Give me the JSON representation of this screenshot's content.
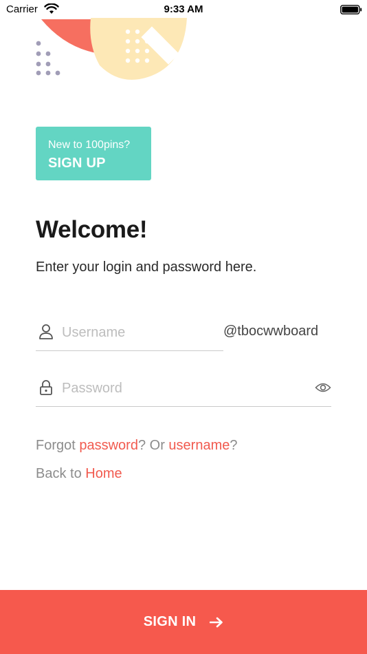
{
  "status_bar": {
    "carrier": "Carrier",
    "time": "9:33 AM"
  },
  "signup": {
    "prompt": "New to 100pins?",
    "action_label": "SIGN UP"
  },
  "heading": "Welcome!",
  "subtitle": "Enter your login and password here.",
  "username_field": {
    "placeholder": "Username",
    "value": "",
    "domain_suffix": "@tbocwwboard"
  },
  "password_field": {
    "placeholder": "Password",
    "value": ""
  },
  "forgot": {
    "prefix": "Forgot ",
    "password_link": "password",
    "middle": "? Or ",
    "username_link": "username",
    "suffix": "?"
  },
  "back": {
    "prefix": "Back to ",
    "home_link": "Home"
  },
  "signin": {
    "label": "SIGN IN"
  },
  "colors": {
    "accent": "#f6594d",
    "signup_teal": "#63d5c3",
    "decor_yellow": "#fde8b6",
    "decor_red": "#f66f60",
    "decor_dots": "#a19db7"
  },
  "icons": [
    "wifi-icon",
    "battery-icon",
    "user-icon",
    "lock-icon",
    "eye-icon",
    "arrow-right-icon"
  ]
}
